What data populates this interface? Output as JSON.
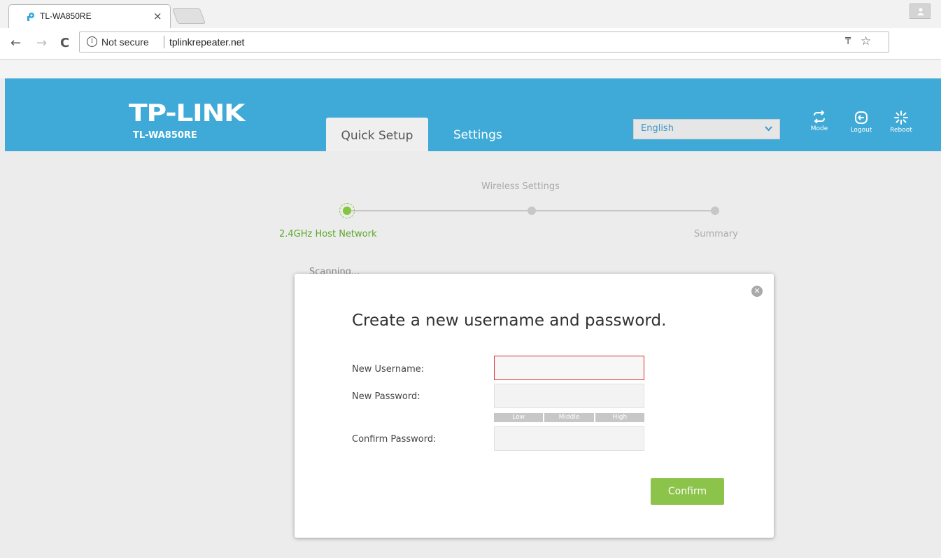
{
  "browser": {
    "tab_title": "TL-WA850RE",
    "tab_close": "×",
    "security_label": "Not secure",
    "url": "tplinkrepeater.net"
  },
  "header": {
    "logo": "TP-LINK",
    "model": "TL-WA850RE",
    "tabs": {
      "quick_setup": "Quick Setup",
      "settings": "Settings"
    },
    "language": "English",
    "icons": {
      "mode": "Mode",
      "logout": "Logout",
      "reboot": "Reboot"
    },
    "accent_color": "#3faad7"
  },
  "progress": {
    "top_label": "Wireless Settings",
    "step1_label": "2.4GHz Host Network",
    "step3_label": "Summary",
    "scanning_label": "Scanning...",
    "active_color": "#83c63f"
  },
  "modal": {
    "title": "Create a new username and password.",
    "username_label": "New Username:",
    "password_label": "New Password:",
    "confirm_label": "Confirm Password:",
    "username_value": "",
    "password_value": "",
    "confirm_value": "",
    "strength": {
      "low": "Low",
      "middle": "Middle",
      "high": "High"
    },
    "confirm_button": "Confirm",
    "button_color": "#8cc34a"
  }
}
